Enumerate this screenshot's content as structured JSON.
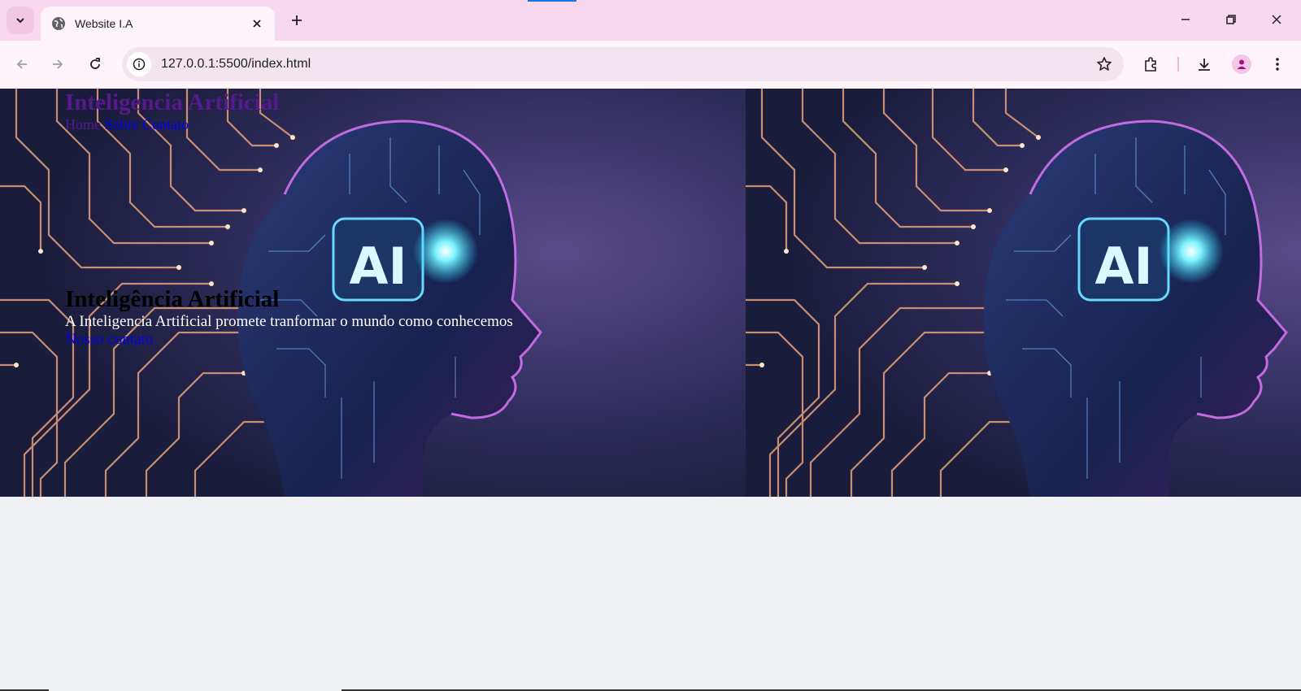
{
  "browser": {
    "tab_title": "Website I.A",
    "url": "127.0.0.1:5500/index.html",
    "colors": {
      "tabstrip": "#f8d8ef",
      "toolbar": "#fff4fb",
      "omnibox": "#f3e5f0"
    }
  },
  "page": {
    "site_title": "Inteligencia Artificial",
    "nav": [
      {
        "label": "Home"
      },
      {
        "label": "Sobre"
      },
      {
        "label": "Contato"
      }
    ],
    "hero": {
      "title": "Inteligência Artificial",
      "subtitle": "A Inteligencia Artificial promete tranformar o mundo como conhecemos",
      "link": "Nosso contato"
    },
    "hero_image": {
      "badge_text": "AI"
    },
    "colors": {
      "background": "#eff0f4",
      "link": "#0000ee",
      "visited": "#551a8b"
    }
  }
}
